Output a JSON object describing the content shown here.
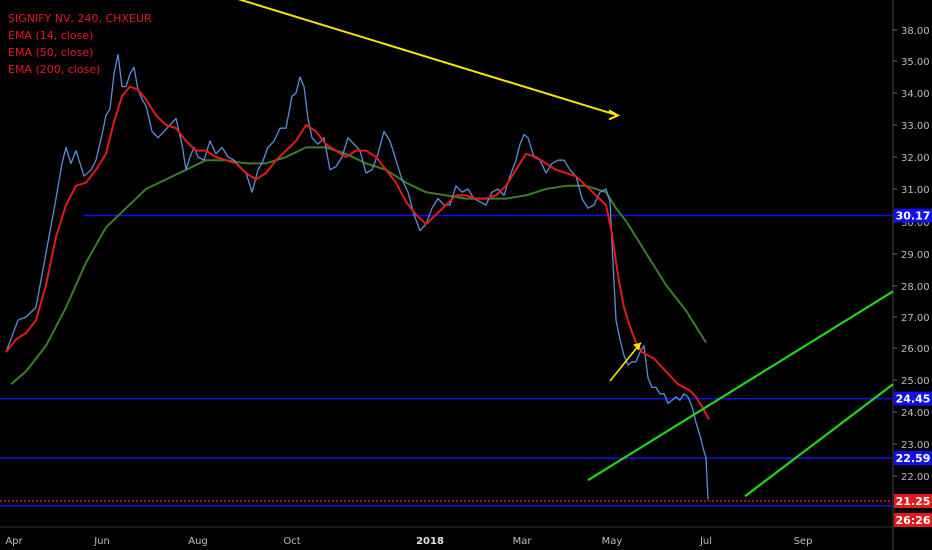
{
  "legend": {
    "title": "SIGNIFY NV, 240, CHXEUR",
    "ema14": "EMA (14, close)",
    "ema50": "EMA (50, close)",
    "ema200": "EMA (200, close)"
  },
  "colors": {
    "background": "#000000",
    "price": "#5b8fd6",
    "ema14": "#e31a1c",
    "ema50": "#3a7d2a",
    "trendline": "#f5e400",
    "channel": "#22d61e",
    "level": "#1010e8",
    "current": "#e31a1c"
  },
  "chart_data": {
    "type": "line",
    "xlabel": "",
    "ylabel": "",
    "ylim": [
      20.2,
      38.6
    ],
    "x_ticks": [
      "Apr",
      "Jun",
      "Aug",
      "Oct",
      "2018",
      "Mar",
      "May",
      "Jul",
      "Sep"
    ],
    "bold_x_ticks": [
      "2018"
    ],
    "y_ticks": [
      "38.00",
      "35.00",
      "34.00",
      "33.00",
      "32.00",
      "31.00",
      "30.00",
      "29.00",
      "28.00",
      "27.00",
      "26.00",
      "25.00",
      "24.00",
      "23.00",
      "22.00"
    ],
    "series": [
      {
        "name": "",
        "kind": "price",
        "x": [
          0,
          6,
          12,
          20,
          30,
          40,
          50,
          56,
          60,
          65,
          70,
          78,
          85,
          90,
          96,
          100,
          104,
          108,
          112,
          116,
          120,
          124,
          128,
          132,
          136,
          140,
          146,
          152,
          158,
          164,
          170,
          176,
          180,
          184,
          188,
          192,
          198,
          204,
          210,
          216,
          222,
          228,
          234,
          240,
          246,
          252,
          256,
          262,
          268,
          274,
          280,
          286,
          290,
          294,
          298,
          302,
          306,
          312,
          318,
          324,
          330,
          336,
          342,
          348,
          354,
          360,
          366,
          372,
          378,
          384,
          390,
          396,
          402,
          408,
          414,
          420,
          426,
          432,
          438,
          444,
          450,
          456,
          462,
          468,
          474,
          480,
          486,
          492,
          498,
          504,
          510,
          514,
          518,
          522,
          528,
          534,
          540,
          546,
          552,
          558,
          564,
          570,
          576,
          582,
          588,
          594,
          600,
          604,
          606,
          608,
          610,
          614,
          618,
          622,
          626,
          630,
          634,
          638,
          642,
          646,
          650,
          654,
          658,
          662,
          666,
          670,
          674,
          678,
          682,
          686,
          690,
          694,
          698,
          700,
          702
        ],
        "values": [
          25.9,
          26.4,
          26.9,
          27.0,
          27.3,
          29.0,
          30.7,
          31.8,
          32.3,
          31.8,
          32.2,
          31.4,
          31.6,
          31.9,
          32.7,
          33.3,
          33.5,
          34.6,
          35.2,
          34.2,
          34.2,
          34.6,
          34.8,
          34.1,
          33.8,
          33.6,
          32.8,
          32.6,
          32.8,
          33.0,
          33.2,
          32.4,
          31.6,
          32.0,
          32.3,
          32.0,
          31.9,
          32.5,
          32.1,
          32.3,
          32.0,
          31.9,
          31.7,
          31.5,
          30.9,
          31.6,
          31.8,
          32.3,
          32.5,
          32.9,
          32.9,
          33.9,
          34.0,
          34.5,
          34.2,
          33.2,
          32.6,
          32.4,
          32.6,
          31.6,
          31.7,
          32.0,
          32.6,
          32.4,
          32.2,
          31.5,
          31.6,
          32.1,
          32.8,
          32.5,
          31.9,
          31.3,
          30.9,
          30.2,
          29.7,
          29.9,
          30.4,
          30.7,
          30.5,
          30.5,
          31.1,
          30.9,
          31.0,
          30.7,
          30.6,
          30.5,
          30.9,
          31.0,
          30.8,
          31.4,
          31.9,
          32.4,
          32.7,
          32.6,
          32.0,
          31.9,
          31.5,
          31.8,
          31.9,
          31.9,
          31.6,
          31.4,
          30.7,
          30.4,
          30.5,
          30.9,
          31.0,
          30.6,
          29.3,
          28.1,
          26.9,
          26.3,
          25.8,
          25.5,
          25.6,
          25.6,
          25.9,
          26.1,
          25.1,
          24.8,
          24.8,
          24.6,
          24.6,
          24.3,
          24.4,
          24.5,
          24.4,
          24.6,
          24.5,
          24.2,
          23.7,
          23.3,
          22.8,
          22.6,
          21.3
        ]
      },
      {
        "name": "",
        "kind": "ema14",
        "x": [
          0,
          10,
          20,
          30,
          40,
          50,
          60,
          70,
          80,
          90,
          100,
          108,
          116,
          124,
          132,
          140,
          150,
          160,
          170,
          180,
          190,
          200,
          210,
          220,
          230,
          240,
          250,
          260,
          270,
          280,
          290,
          300,
          310,
          320,
          330,
          340,
          350,
          360,
          370,
          380,
          390,
          400,
          410,
          420,
          430,
          440,
          450,
          460,
          470,
          480,
          490,
          500,
          510,
          520,
          530,
          540,
          550,
          560,
          570,
          580,
          590,
          600,
          606,
          612,
          618,
          624,
          630,
          636,
          642,
          648,
          654,
          660,
          666,
          672,
          678,
          684,
          690,
          696,
          703
        ],
        "values": [
          25.9,
          26.3,
          26.5,
          26.9,
          28.0,
          29.5,
          30.5,
          31.1,
          31.2,
          31.6,
          32.1,
          33.1,
          33.9,
          34.2,
          34.1,
          33.8,
          33.3,
          33.0,
          32.9,
          32.5,
          32.2,
          32.2,
          32.0,
          31.9,
          31.8,
          31.5,
          31.3,
          31.5,
          31.9,
          32.2,
          32.5,
          33.0,
          32.8,
          32.4,
          32.2,
          32.0,
          32.2,
          32.2,
          32.0,
          31.6,
          31.2,
          30.6,
          30.2,
          29.9,
          30.2,
          30.5,
          30.8,
          30.8,
          30.7,
          30.7,
          30.8,
          31.1,
          31.6,
          32.1,
          32.0,
          31.8,
          31.6,
          31.5,
          31.4,
          31.1,
          30.8,
          30.5,
          29.6,
          28.3,
          27.3,
          26.7,
          26.2,
          25.9,
          25.8,
          25.7,
          25.5,
          25.3,
          25.1,
          24.9,
          24.8,
          24.7,
          24.5,
          24.2,
          23.8
        ]
      },
      {
        "name": "",
        "kind": "ema50",
        "x": [
          5,
          20,
          40,
          60,
          80,
          100,
          120,
          140,
          160,
          180,
          200,
          220,
          240,
          260,
          280,
          300,
          320,
          340,
          360,
          380,
          400,
          420,
          440,
          460,
          480,
          500,
          520,
          540,
          560,
          580,
          600,
          610,
          620,
          630,
          640,
          650,
          660,
          670,
          680,
          690,
          700
        ],
        "values": [
          24.9,
          25.3,
          26.1,
          27.3,
          28.7,
          29.8,
          30.4,
          31.0,
          31.3,
          31.6,
          31.9,
          31.9,
          31.8,
          31.8,
          32.0,
          32.3,
          32.3,
          32.1,
          31.8,
          31.6,
          31.2,
          30.9,
          30.8,
          30.7,
          30.7,
          30.7,
          30.8,
          31.0,
          31.1,
          31.1,
          30.9,
          30.4,
          30.0,
          29.5,
          29.0,
          28.5,
          28.0,
          27.6,
          27.2,
          26.7,
          26.2
        ]
      }
    ],
    "annotations": [
      {
        "kind": "trendline",
        "x": [
          106,
          618
        ],
        "values": [
          38.2,
          33.3
        ]
      },
      {
        "kind": "arrow",
        "x": [
          610,
          641
        ],
        "values": [
          25.0,
          26.2
        ]
      },
      {
        "kind": "channel",
        "x": [
          588,
          893
        ],
        "values": [
          21.9,
          27.8
        ]
      },
      {
        "kind": "channel",
        "x": [
          745,
          893
        ],
        "values": [
          21.4,
          24.9
        ]
      },
      {
        "kind": "hline",
        "level": 30.17,
        "x_start": 84
      },
      {
        "kind": "hline",
        "level": 24.45,
        "x_start": 0
      },
      {
        "kind": "hline",
        "level": 22.59,
        "x_start": 0
      },
      {
        "kind": "hline",
        "level": 21.25,
        "x_start": 0,
        "style": "dotted"
      },
      {
        "kind": "hline",
        "level": 21.1,
        "x_start": 0
      }
    ],
    "price_labels": [
      {
        "value": 30.17,
        "text": "30.17",
        "color": "#1010e8"
      },
      {
        "value": 24.45,
        "text": "24.45",
        "color": "#1010e8"
      },
      {
        "value": 22.59,
        "text": "22.59",
        "color": "#1010e8"
      },
      {
        "value": 21.25,
        "text": "21.25",
        "color": "#e31a1c"
      }
    ],
    "countdown": "26:26"
  }
}
